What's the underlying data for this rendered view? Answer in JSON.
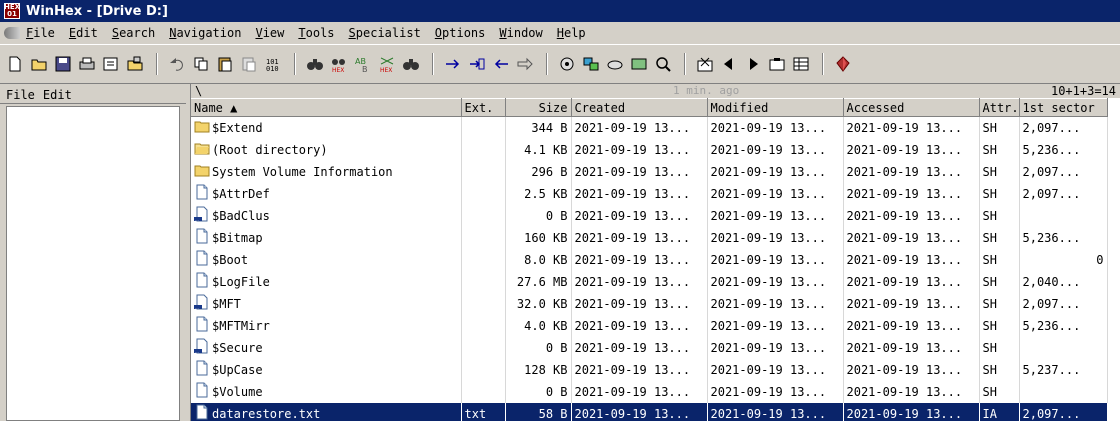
{
  "window": {
    "title": "WinHex - [Drive D:]",
    "icon_text_top": "HEX",
    "icon_text_bottom": "01"
  },
  "menu": [
    "File",
    "Edit",
    "Search",
    "Navigation",
    "View",
    "Tools",
    "Specialist",
    "Options",
    "Window",
    "Help"
  ],
  "left_menu": [
    "File",
    "Edit"
  ],
  "path": {
    "current": "\\",
    "age": "1 min. ago",
    "count": "10+1+3=14"
  },
  "columns": [
    "Name ▲",
    "Ext.",
    "Size",
    "Created",
    "Modified",
    "Accessed",
    "Attr.",
    "1st sector"
  ],
  "rows": [
    {
      "icon": "folder",
      "name": "$Extend",
      "ext": "",
      "size": "344 B",
      "created": "2021-09-19  13...",
      "modified": "2021-09-19  13...",
      "accessed": "2021-09-19  13...",
      "attr": "SH",
      "sector": "2,097..."
    },
    {
      "icon": "folder-open",
      "name": "(Root directory)",
      "ext": "",
      "size": "4.1 KB",
      "created": "2021-09-19  13...",
      "modified": "2021-09-19  13...",
      "accessed": "2021-09-19  13...",
      "attr": "SH",
      "sector": "5,236..."
    },
    {
      "icon": "folder",
      "name": "System Volume Information",
      "ext": "",
      "size": "296 B",
      "created": "2021-09-19  13...",
      "modified": "2021-09-19  13...",
      "accessed": "2021-09-19  13...",
      "attr": "SH",
      "sector": "2,097..."
    },
    {
      "icon": "file",
      "name": "$AttrDef",
      "ext": "",
      "size": "2.5 KB",
      "created": "2021-09-19  13...",
      "modified": "2021-09-19  13...",
      "accessed": "2021-09-19  13...",
      "attr": "SH",
      "sector": "2,097..."
    },
    {
      "icon": "file-ads",
      "name": "$BadClus",
      "ext": "",
      "size": "0 B",
      "created": "2021-09-19  13...",
      "modified": "2021-09-19  13...",
      "accessed": "2021-09-19  13...",
      "attr": "SH",
      "sector": ""
    },
    {
      "icon": "file",
      "name": "$Bitmap",
      "ext": "",
      "size": "160 KB",
      "created": "2021-09-19  13...",
      "modified": "2021-09-19  13...",
      "accessed": "2021-09-19  13...",
      "attr": "SH",
      "sector": "5,236..."
    },
    {
      "icon": "file",
      "name": "$Boot",
      "ext": "",
      "size": "8.0 KB",
      "created": "2021-09-19  13...",
      "modified": "2021-09-19  13...",
      "accessed": "2021-09-19  13...",
      "attr": "SH",
      "sector": "0",
      "sector_right": true
    },
    {
      "icon": "file",
      "name": "$LogFile",
      "ext": "",
      "size": "27.6 MB",
      "created": "2021-09-19  13...",
      "modified": "2021-09-19  13...",
      "accessed": "2021-09-19  13...",
      "attr": "SH",
      "sector": "2,040..."
    },
    {
      "icon": "file-ads",
      "name": "$MFT",
      "ext": "",
      "size": "32.0 KB",
      "created": "2021-09-19  13...",
      "modified": "2021-09-19  13...",
      "accessed": "2021-09-19  13...",
      "attr": "SH",
      "sector": "2,097..."
    },
    {
      "icon": "file",
      "name": "$MFTMirr",
      "ext": "",
      "size": "4.0 KB",
      "created": "2021-09-19  13...",
      "modified": "2021-09-19  13...",
      "accessed": "2021-09-19  13...",
      "attr": "SH",
      "sector": "5,236..."
    },
    {
      "icon": "file-ads",
      "name": "$Secure",
      "ext": "",
      "size": "0 B",
      "created": "2021-09-19  13...",
      "modified": "2021-09-19  13...",
      "accessed": "2021-09-19  13...",
      "attr": "SH",
      "sector": ""
    },
    {
      "icon": "file",
      "name": "$UpCase",
      "ext": "",
      "size": "128 KB",
      "created": "2021-09-19  13...",
      "modified": "2021-09-19  13...",
      "accessed": "2021-09-19  13...",
      "attr": "SH",
      "sector": "5,237..."
    },
    {
      "icon": "file",
      "name": "$Volume",
      "ext": "",
      "size": "0 B",
      "created": "2021-09-19  13...",
      "modified": "2021-09-19  13...",
      "accessed": "2021-09-19  13...",
      "attr": "SH",
      "sector": ""
    },
    {
      "icon": "file",
      "name": "datarestore.txt",
      "ext": "txt",
      "size": "58 B",
      "created": "2021-09-19  13...",
      "modified": "2021-09-19  13...",
      "accessed": "2021-09-19  13...",
      "attr": "IA",
      "sector": "2,097...",
      "selected": true
    }
  ],
  "colors": {
    "titlebar": "#0a246a",
    "selection": "#0a246a",
    "folder": "#f3d36b",
    "file": "#dbe9f7"
  }
}
